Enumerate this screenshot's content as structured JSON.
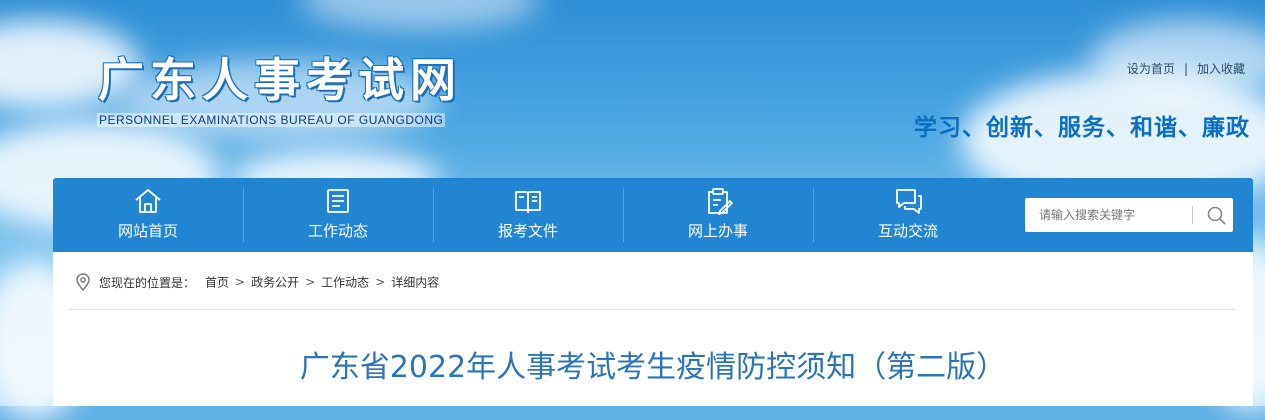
{
  "header": {
    "logo_cn": "广东人事考试网",
    "logo_en": "PERSONNEL EXAMINATIONS BUREAU OF GUANGDONG",
    "top_links": {
      "set_home": "设为首页",
      "separator": "|",
      "bookmark": "加入收藏"
    },
    "slogan": "学习、创新、服务、和谐、廉政"
  },
  "nav": {
    "items": [
      {
        "label": "网站首页",
        "icon": "home-icon"
      },
      {
        "label": "工作动态",
        "icon": "document-list-icon"
      },
      {
        "label": "报考文件",
        "icon": "open-book-icon"
      },
      {
        "label": "网上办事",
        "icon": "clipboard-edit-icon"
      },
      {
        "label": "互动交流",
        "icon": "chat-bubbles-icon"
      }
    ],
    "search": {
      "placeholder": "请输入搜索关键字",
      "icon": "search-icon"
    }
  },
  "breadcrumb": {
    "icon": "location-pin-icon",
    "prefix": "您现在的位置是：",
    "items": [
      "首页",
      "政务公开",
      "工作动态",
      "详细内容"
    ],
    "separator": ">"
  },
  "article": {
    "title": "广东省2022年人事考试考生疫情防控须知（第二版）"
  },
  "colors": {
    "nav_background": "#2285d1",
    "title": "#2b74b8",
    "slogan": "#0a6fc2",
    "logo_outline": "#1a6fb7"
  }
}
